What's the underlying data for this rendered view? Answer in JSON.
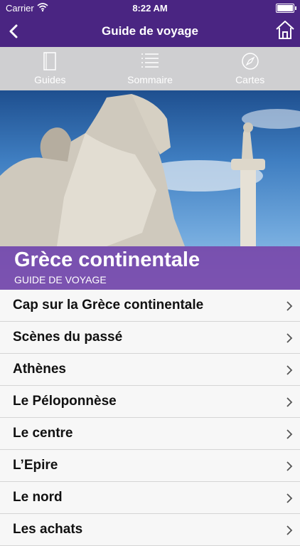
{
  "status": {
    "carrier": "Carrier",
    "time": "8:22 AM"
  },
  "navbar": {
    "title": "Guide de voyage",
    "back_icon": "chevron-left-icon",
    "home_icon": "home-icon"
  },
  "tabs": [
    {
      "label": "Guides",
      "icon": "book-icon"
    },
    {
      "label": "Sommaire",
      "icon": "list-icon"
    },
    {
      "label": "Cartes",
      "icon": "compass-icon"
    }
  ],
  "hero": {
    "title": "Grèce continentale",
    "subtitle": "GUIDE DE VOYAGE"
  },
  "list": {
    "items": [
      "Cap sur la Grèce continentale",
      "Scènes du passé",
      "Athènes",
      "Le Péloponnèse",
      "Le centre",
      "L’Epire",
      "Le nord",
      "Les achats"
    ]
  },
  "colors": {
    "nav_bg": "#4a2582",
    "tab_bg": "#cfcfd1",
    "hero_band": "#7846aa"
  }
}
